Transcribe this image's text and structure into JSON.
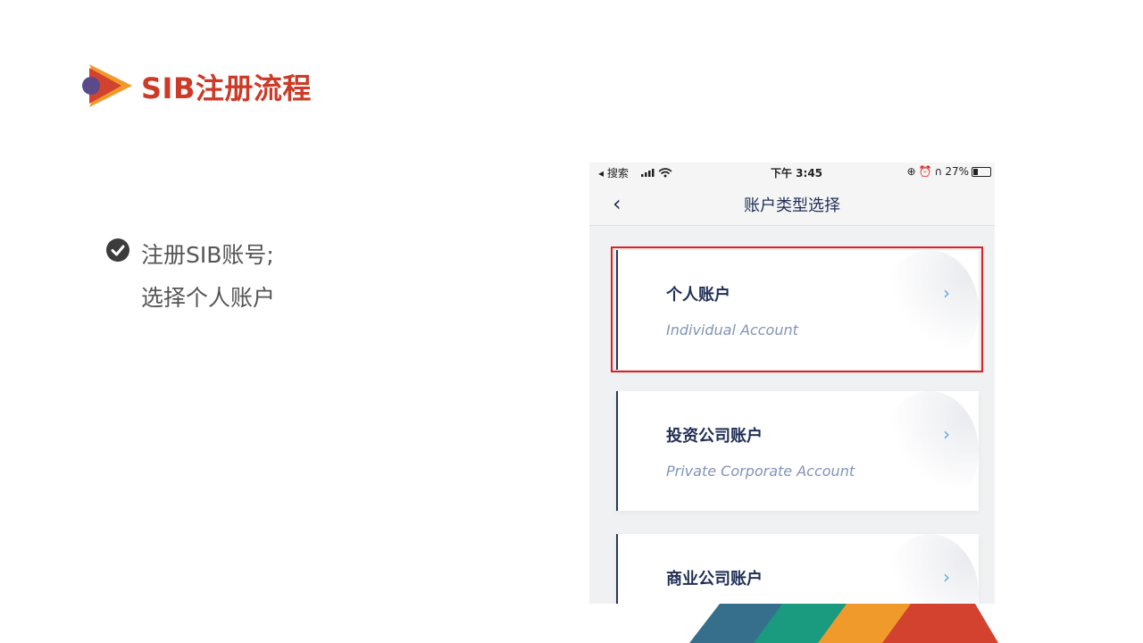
{
  "slide": {
    "title": "SIB注册流程",
    "bullet_lines": [
      "注册SIB账号;",
      "选择个人账户"
    ]
  },
  "phone": {
    "status": {
      "left": "◂ 搜索",
      "time": "下午 3:45",
      "battery": "27%"
    },
    "nav": {
      "back": "‹",
      "title": "账户类型选择"
    },
    "cards": [
      {
        "title": "个人账户",
        "subtitle": "Individual Account",
        "chevron": "›"
      },
      {
        "title": "投资公司账户",
        "subtitle": "Private Corporate Account",
        "chevron": "›"
      },
      {
        "title": "商业公司账户",
        "subtitle": "",
        "chevron": "›"
      }
    ]
  },
  "colors": {
    "accent_red": "#cc3b28",
    "stripe_colors": [
      "#356f8c",
      "#1a9a7e",
      "#ef9a2b",
      "#d3422f"
    ],
    "highlight": "#e02020"
  }
}
